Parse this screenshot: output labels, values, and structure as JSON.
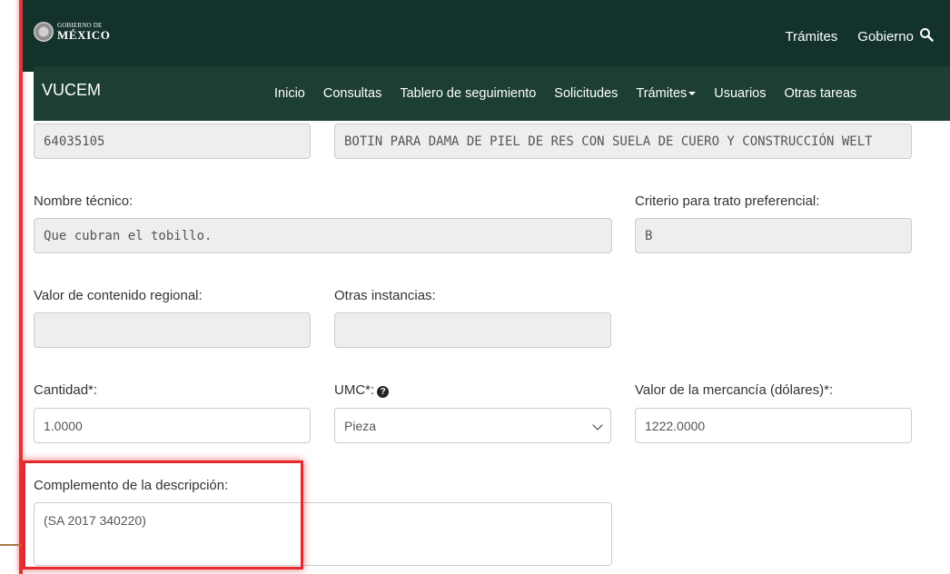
{
  "header": {
    "logo_small": "GOBIERNO DE",
    "logo_big": "MÉXICO",
    "links": [
      "Trámites",
      "Gobierno"
    ],
    "search_icon": "search-icon"
  },
  "nav": {
    "brand": "VUCEM",
    "items": [
      "Inicio",
      "Consultas",
      "Tablero de seguimiento",
      "Solicitudes",
      "Trámites",
      "Usuarios",
      "Otras tareas"
    ]
  },
  "form": {
    "fraccion_value": "64035105",
    "descripcion_value": "BOTIN PARA DAMA DE PIEL DE RES CON SUELA DE CUERO Y CONSTRUCCIÓN WELT",
    "nombre_tecnico_label": "Nombre técnico:",
    "nombre_tecnico_value": "Que cubran el tobillo.",
    "criterio_label": "Criterio para trato preferencial:",
    "criterio_value": "B",
    "valor_regional_label": "Valor de contenido regional:",
    "valor_regional_value": "",
    "otras_instancias_label": "Otras instancias:",
    "otras_instancias_value": "",
    "cantidad_label": "Cantidad*:",
    "cantidad_value": "1.0000",
    "umc_label": "UMC*:",
    "umc_value": "Pieza",
    "valor_mercancia_label": "Valor de la mercancía (dólares)*:",
    "valor_mercancia_value": "1222.0000",
    "complemento_label": "Complemento de la descripción:",
    "complemento_value": "(SA 2017 340220)"
  },
  "colors": {
    "gov_bar": "#13322b",
    "nav_bar": "#1c3e33",
    "highlight": "#e5282d"
  }
}
